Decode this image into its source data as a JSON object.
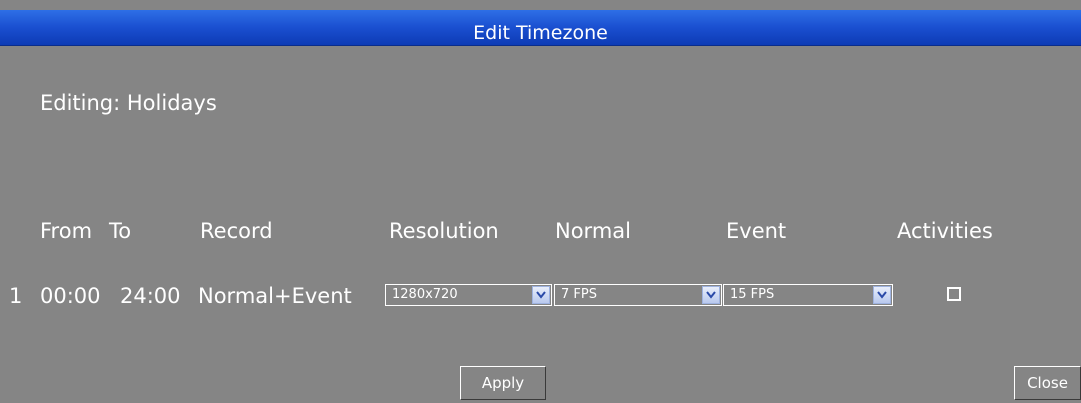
{
  "dialog": {
    "title": "Edit Timezone"
  },
  "editing_label": "Editing: Holidays",
  "table": {
    "headers": {
      "from": "From",
      "to": "To",
      "record": "Record",
      "resolution": "Resolution",
      "normal": "Normal",
      "event": "Event",
      "activities": "Activities"
    },
    "rows": [
      {
        "index": "1",
        "from": "00:00",
        "to": "24:00",
        "record": "Normal+Event",
        "resolution": "1280x720",
        "normal_fps": "7 FPS",
        "event_fps": "15 FPS",
        "activities_checked": false
      }
    ]
  },
  "buttons": {
    "apply": "Apply",
    "close": "Close"
  },
  "colors": {
    "background": "#858585",
    "titlebar": "#1a4fd0",
    "text": "#ffffff"
  },
  "icons": {
    "dropdown": "chevron-down-icon",
    "checkbox": "checkbox-unchecked-icon"
  }
}
